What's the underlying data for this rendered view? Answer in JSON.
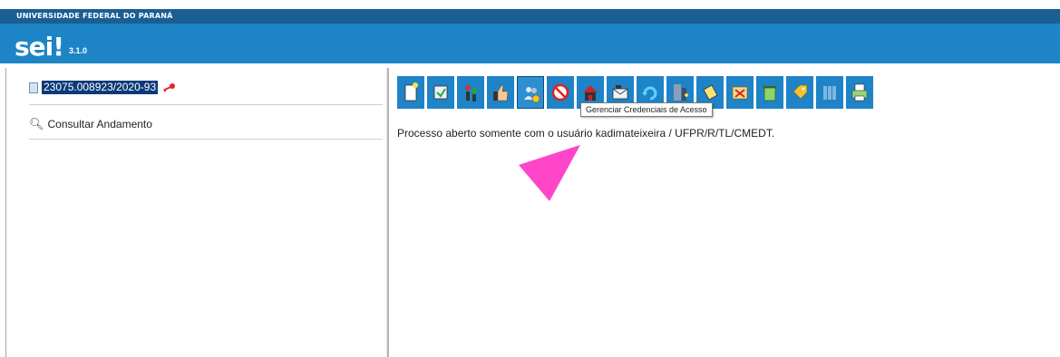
{
  "header": {
    "university": "UNIVERSIDADE FEDERAL DO PARANÁ",
    "app_logo": "sei!",
    "version": "3.1.0"
  },
  "tree": {
    "process_number": "23075.008923/2020-93",
    "consult_label": "Consultar Andamento"
  },
  "toolbar": {
    "icons": [
      "new-document-icon",
      "send-process-icon",
      "relate-process-icon",
      "thumbs-up-icon",
      "manage-credentials-icon",
      "cancel-icon",
      "house-send-icon",
      "email-icon",
      "refresh-icon",
      "attach-process-icon",
      "annotation-icon",
      "map-icon",
      "recycle-icon",
      "tag-icon",
      "list-icon",
      "print-icon"
    ],
    "tooltip": "Gerenciar Credenciais de Acesso"
  },
  "main": {
    "message": "Processo aberto somente com o usuário kadimateixeira / UFPR/R/TL/CMEDT."
  },
  "colors": {
    "header": "#1d85c5",
    "header_band": "#1a5e93",
    "toolbar_button": "#1f83c7",
    "arrow": "#ff45c8"
  }
}
